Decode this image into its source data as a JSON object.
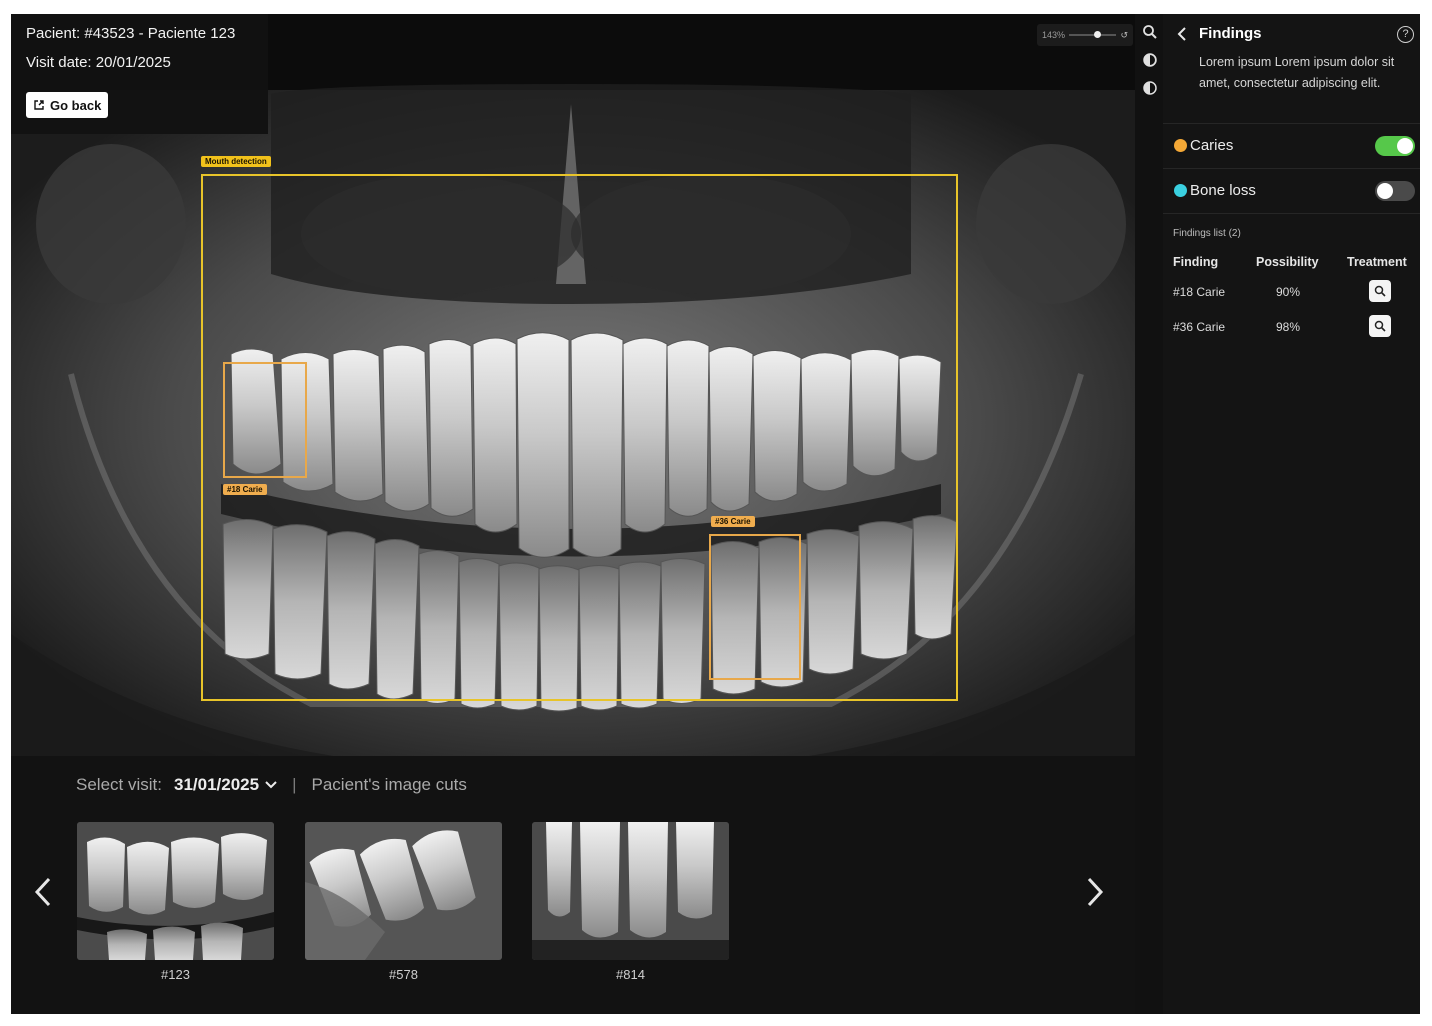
{
  "patient": {
    "id_line": "Pacient: #43523 - Paciente 123",
    "visit_line": "Visit date: 20/01/2025",
    "go_back_label": "Go back"
  },
  "detections": {
    "mouth_label": "Mouth detection",
    "carie_18_label": "#18 Carie",
    "carie_36_label": "#36 Carie"
  },
  "toolbar": {
    "zoom_value": "143%",
    "zoom_level": 0.6,
    "tools": [
      "zoom-icon",
      "brightness-icon",
      "contrast-icon"
    ]
  },
  "findings_panel": {
    "title": "Findings",
    "description": "Lorem ipsum Lorem ipsum dolor sit amet, consectetur adipiscing elit.",
    "layers": [
      {
        "label": "Caries",
        "color": "#f4a836",
        "enabled": true
      },
      {
        "label": "Bone loss",
        "color": "#3ad0e0",
        "enabled": false
      }
    ],
    "switch_on_color": "#56c84a",
    "switch_off_color": "#4a4a4a",
    "list_title": "Findings list (2)",
    "columns": [
      "Finding",
      "Possibility",
      "Treatment"
    ],
    "rows": [
      {
        "finding": "#18 Carie",
        "possibility": "90%"
      },
      {
        "finding": "#36 Carie",
        "possibility": "98%"
      }
    ]
  },
  "visit_selector": {
    "label": "Select visit:",
    "value": "31/01/2025",
    "separator": "|",
    "cuts_label": "Pacient's image cuts"
  },
  "thumbnails": [
    {
      "caption": "#123"
    },
    {
      "caption": "#578"
    },
    {
      "caption": "#814"
    }
  ],
  "colors": {
    "detection_box": "#e8c42a",
    "detection_tag": "#f2c21b",
    "carie_tag": "#f0ad4e"
  }
}
